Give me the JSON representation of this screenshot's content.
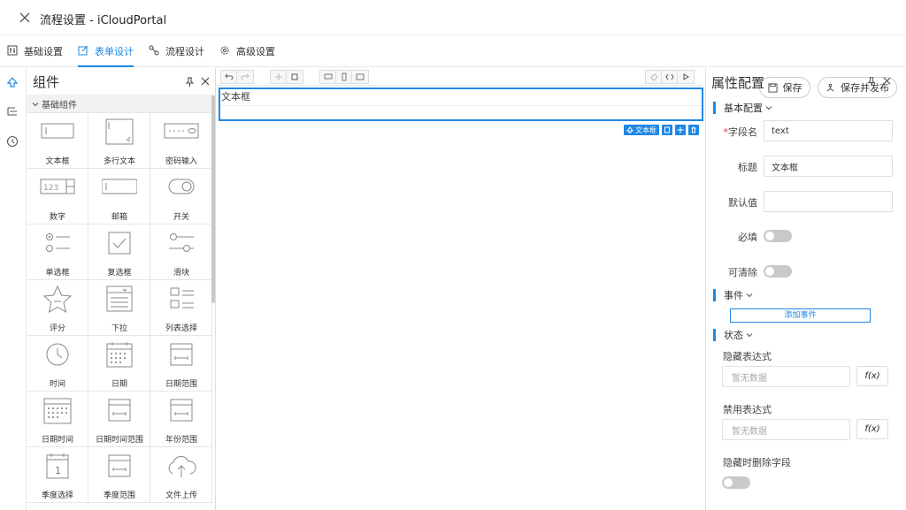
{
  "window": {
    "title": "流程设置 - iCloudPortal"
  },
  "tabs": [
    {
      "label": "基础设置",
      "icon": "settings-grid-icon"
    },
    {
      "label": "表单设计",
      "icon": "edit-icon",
      "active": true
    },
    {
      "label": "流程设计",
      "icon": "flow-icon"
    },
    {
      "label": "高级设置",
      "icon": "gear-icon"
    }
  ],
  "actions": {
    "save": "保存",
    "save_publish": "保存并发布"
  },
  "components_panel": {
    "title": "组件",
    "group": "基础组件",
    "items": [
      {
        "label": "文本框",
        "icon": "textbox-icon"
      },
      {
        "label": "多行文本",
        "icon": "textarea-icon"
      },
      {
        "label": "密码输入",
        "icon": "password-icon"
      },
      {
        "label": "数字",
        "icon": "number-icon"
      },
      {
        "label": "邮箱",
        "icon": "email-icon"
      },
      {
        "label": "开关",
        "icon": "switch-icon"
      },
      {
        "label": "单选框",
        "icon": "radio-icon"
      },
      {
        "label": "复选框",
        "icon": "checkbox-icon"
      },
      {
        "label": "滑块",
        "icon": "slider-icon"
      },
      {
        "label": "评分",
        "icon": "star-icon"
      },
      {
        "label": "下拉",
        "icon": "select-icon"
      },
      {
        "label": "列表选择",
        "icon": "list-select-icon"
      },
      {
        "label": "时间",
        "icon": "clock-icon"
      },
      {
        "label": "日期",
        "icon": "calendar-icon"
      },
      {
        "label": "日期范围",
        "icon": "date-range-icon"
      },
      {
        "label": "日期时间",
        "icon": "datetime-icon"
      },
      {
        "label": "日期时间范围",
        "icon": "datetime-range-icon"
      },
      {
        "label": "年份范围",
        "icon": "year-range-icon"
      },
      {
        "label": "季度选择",
        "icon": "quarter-icon"
      },
      {
        "label": "季度范围",
        "icon": "quarter-range-icon"
      },
      {
        "label": "文件上传",
        "icon": "upload-icon"
      }
    ]
  },
  "canvas": {
    "field_label": "文本框",
    "field_tag": "文本框"
  },
  "properties": {
    "title": "属性配置",
    "basic_section": "基本配置",
    "field_name_label": "字段名",
    "field_name_value": "text",
    "title_label": "标题",
    "title_value": "文本框",
    "default_label": "默认值",
    "default_value": "",
    "required_label": "必填",
    "clearable_label": "可清除",
    "events_section": "事件",
    "add_event": "添加事件",
    "state_section": "状态",
    "hide_expr_label": "隐藏表达式",
    "hide_expr_placeholder": "暂无数据",
    "disable_expr_label": "禁用表达式",
    "disable_expr_placeholder": "暂无数据",
    "fx_label": "f(x)",
    "hide_delete_label": "隐藏时删除字段"
  },
  "colors": {
    "accent": "#1e88e5",
    "required": "#e33333"
  }
}
